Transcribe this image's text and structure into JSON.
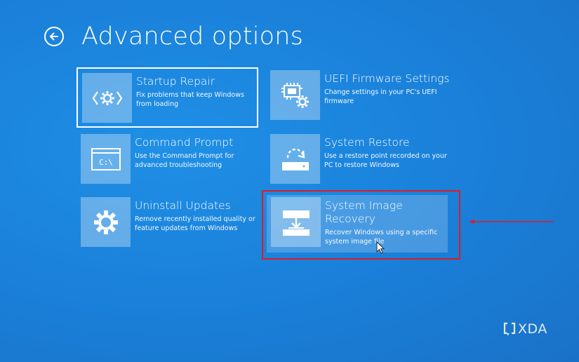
{
  "header": {
    "title": "Advanced options",
    "back_icon": "back-arrow-icon"
  },
  "options": [
    {
      "id": "startup-repair",
      "title": "Startup Repair",
      "description": "Fix problems that keep Windows from loading",
      "icon": "code-gear-icon",
      "focused": true
    },
    {
      "id": "uefi-firmware-settings",
      "title": "UEFI Firmware Settings",
      "description": "Change settings in your PC's UEFI firmware",
      "icon": "chip-gear-icon"
    },
    {
      "id": "command-prompt",
      "title": "Command Prompt",
      "description": "Use the Command Prompt for advanced troubleshooting",
      "icon": "terminal-icon",
      "icon_text": "C:\\"
    },
    {
      "id": "system-restore",
      "title": "System Restore",
      "description": "Use a restore point recorded on your PC to restore Windows",
      "icon": "restore-drive-icon"
    },
    {
      "id": "uninstall-updates",
      "title": "Uninstall Updates",
      "description": "Remove recently installed quality or feature updates from Windows",
      "icon": "gear-icon"
    },
    {
      "id": "system-image-recovery",
      "title": "System Image Recovery",
      "description": "Recover Windows using a specific system image file",
      "icon": "image-drive-download-icon",
      "hovered": true,
      "highlighted": true
    }
  ],
  "annotation": {
    "highlight_color": "#e01b24",
    "arrow_color": "#e01b24"
  },
  "watermark": {
    "text": "XDA",
    "icon": "xda-logo-icon"
  },
  "colors": {
    "background": "#1a7fd8",
    "tile": "rgba(255,255,255,0.32)",
    "text": "#ffffff"
  }
}
